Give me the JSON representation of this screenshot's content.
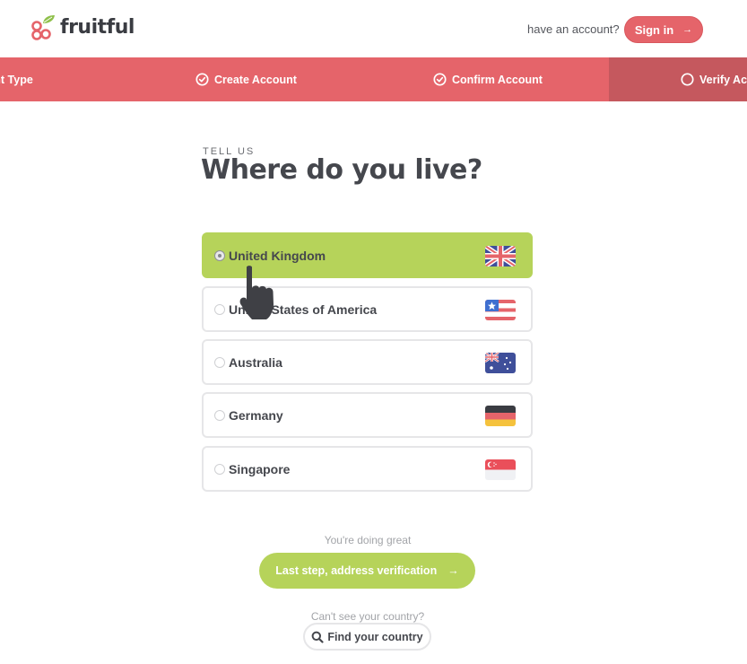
{
  "header": {
    "brand": "fruitful",
    "account_prompt": "have an account?",
    "signin_label": "Sign in",
    "signin_arrow": "→"
  },
  "steps": [
    {
      "label": "Account Type",
      "visible_text": "ount Type",
      "status": "complete",
      "icon": "none"
    },
    {
      "label": "Create Account",
      "status": "complete",
      "icon": "check-circle-icon"
    },
    {
      "label": "Confirm Account",
      "status": "complete",
      "icon": "check-circle-icon"
    },
    {
      "label": "Verify Address",
      "visible_text": "Verify Ac",
      "status": "active",
      "icon": "empty-circle-icon"
    }
  ],
  "page": {
    "eyebrow": "TELL US",
    "title": "Where do you live?"
  },
  "countries": [
    {
      "name": "United Kingdom",
      "flag": "uk-flag-icon",
      "selected": true
    },
    {
      "name": "United States of America",
      "flag": "us-flag-icon",
      "selected": false
    },
    {
      "name": "Australia",
      "flag": "australia-flag-icon",
      "selected": false
    },
    {
      "name": "Germany",
      "flag": "germany-flag-icon",
      "selected": false
    },
    {
      "name": "Singapore",
      "flag": "singapore-flag-icon",
      "selected": false
    }
  ],
  "footer": {
    "encouragement": "You're doing great",
    "next_label": "Last step, address verification",
    "next_arrow": "→",
    "cant_see": "Can't see your country?",
    "find_label": "Find your country"
  },
  "colors": {
    "brand_red": "#e5646a",
    "active_step": "#c5585e",
    "accent_green": "#b6d35a",
    "text_dark": "#45474d"
  }
}
